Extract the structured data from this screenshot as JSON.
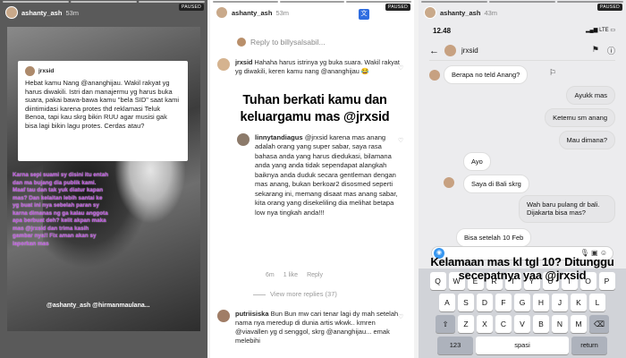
{
  "panel1": {
    "username": "ashanty_ash",
    "age": "53m",
    "paused": "PAUSED",
    "card_username": "jrxsid",
    "card_text": "Hebat kamu Nang @ananghijau. Wakil rakyat yg harus diwakili. Istri dan manajermu yg harus buka suara, pakai bawa-bawa kamu \"bela SID\" saat kami diintimidasi karena protes thd reklamasi Teluk Benoa, tapi kau skrg bikin RUU agar musisi gak bisa lagi bikin lagu protes. Cerdas atau?",
    "purple_text": "Karna sepi suami sy disini itu entah dan ma bujang dia publik kami. Maaf tau dan tak yuk diatur kapan mas? Dan kelaitan lebih santai ke yg buat ini nya sebelah paran sy karna dimanas ng ga kalau anggota apa berbuat deh? kelit akpan maka mas @jrxsid dan trima kasih gambar nya!! Fix aman akan sy laporkan mas",
    "credit": "@ashanty_ash @hirmanmaulana..."
  },
  "panel2": {
    "username": "ashanty_ash",
    "age": "53m",
    "paused": "PAUSED",
    "reply_to": "Reply to billysalsabil...",
    "comment1_user": "jrxsid",
    "comment1_text": "Hahaha harus istrinya yg buka suara. Wakil rakyat yg diwakili, keren kamu nang @ananghijau 😂",
    "big_caption": "Tuhan berkati kamu dan keluargamu mas @jrxsid",
    "comment2_user": "linnytandiagus",
    "comment2_text": "@jrxsid karena mas anang adalah orang yang super sabar, saya rasa bahasa anda yang harus diedukasi, bilamana anda yang anda tidak sependapat alangkah baiknya anda duduk secara gentleman dengan mas anang, bukan berkoar2 disosmed seperti sekarang ini, memang disaat mas anang sabar, kita orang yang disekeliling dia melihat betapa low nya tingkah anda!!!",
    "comment2_age": "6m",
    "comment2_likes": "1 like",
    "comment2_reply": "Reply",
    "view_more": "View more replies (37)",
    "comment3_user": "putriisiska",
    "comment3_text": "Bun Bun mw cari tenar lagi dy mah setelah nama nya meredup di dunia artis wkwk.. kmren @viavallen yg d senggol, skrg @ananghijau... emak melebihi"
  },
  "panel3": {
    "username": "ashanty_ash",
    "age": "43m",
    "paused": "PAUSED",
    "time": "12.48",
    "signal": "LTE",
    "chat_name": "jrxsid",
    "messages": [
      {
        "dir": "in",
        "text": "Berapa no teld Anang?"
      },
      {
        "dir": "out",
        "text": "Ayukk mas"
      },
      {
        "dir": "out",
        "text": "Ketemu sm anang"
      },
      {
        "dir": "out",
        "text": "Mau dimana?"
      },
      {
        "dir": "in",
        "text": "Ayo"
      },
      {
        "dir": "in",
        "text": "Saya di Bali skrg"
      },
      {
        "dir": "out",
        "text": "Wah baru pulang dr bali. Dijakarta bisa mas?"
      },
      {
        "dir": "in",
        "text": "Bisa setelah 10 Feb"
      }
    ],
    "big_caption": "Kelamaan mas kl tgl 10? Ditunggu secepatnya yaa @jrxsid",
    "keyboard": {
      "row1": [
        "Q",
        "W",
        "E",
        "R",
        "T",
        "Y",
        "U",
        "I",
        "O",
        "P"
      ],
      "row2": [
        "A",
        "S",
        "D",
        "F",
        "G",
        "H",
        "J",
        "K",
        "L"
      ],
      "row3": [
        "⇧",
        "Z",
        "X",
        "C",
        "V",
        "B",
        "N",
        "M",
        "⌫"
      ],
      "key_123": "123",
      "key_space": "spasi",
      "key_return": "return"
    }
  }
}
